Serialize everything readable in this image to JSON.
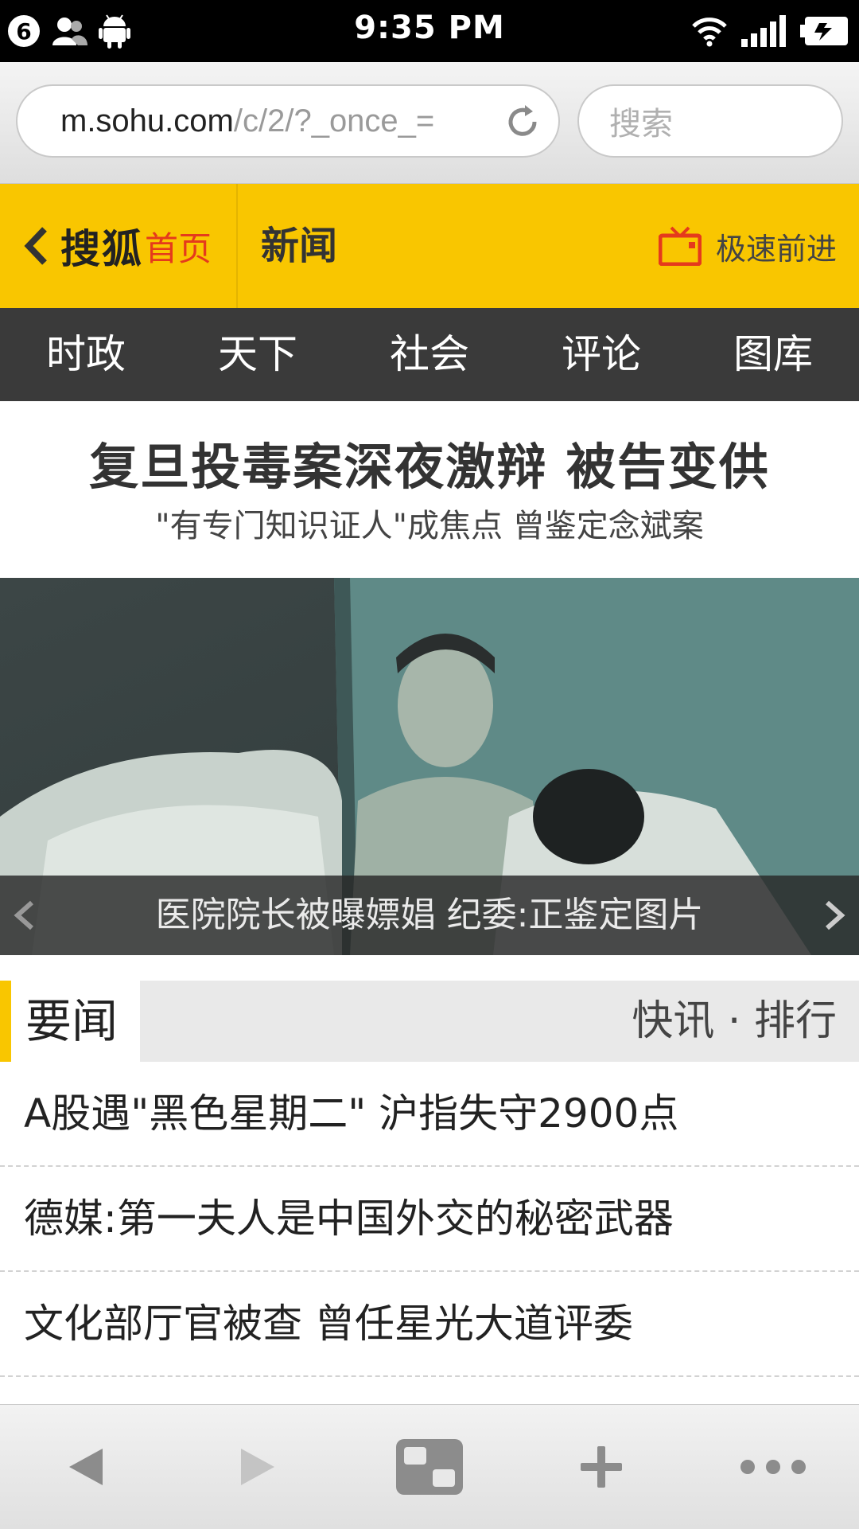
{
  "status_bar": {
    "notification_count": "6",
    "time": "9:35 PM",
    "icons": [
      "people-icon",
      "android-icon",
      "wifi-icon",
      "signal-icon",
      "battery-icon"
    ]
  },
  "browser": {
    "url_host": "m.sohu.com",
    "url_path": "/c/2/?_once_=",
    "search_placeholder": "搜索",
    "toolbar_icons": [
      "back-icon",
      "forward-icon",
      "tabs-icon",
      "new-tab-icon",
      "more-icon"
    ]
  },
  "header": {
    "logo": "搜狐",
    "home_label": "首页",
    "section": "新闻",
    "speed_label": "极速前进",
    "accent": "#f9c600",
    "home_color": "#e53a1c"
  },
  "nav": {
    "items": [
      "时政",
      "天下",
      "社会",
      "评论",
      "图库"
    ]
  },
  "headline": {
    "title": "复旦投毒案深夜激辩 被告变供",
    "subtitle": "\"有专门知识证人\"成焦点 曾鉴定念斌案"
  },
  "slideshow": {
    "caption": "医院院长被曝嫖娼 纪委:正鉴定图片"
  },
  "section": {
    "title": "要闻",
    "links": "快讯 · 排行"
  },
  "news": [
    "A股遇\"黑色星期二\" 沪指失守2900点",
    "德媒:第一夫人是中国外交的秘密武器",
    "文化部厅官被查 曾任星光大道评委"
  ]
}
